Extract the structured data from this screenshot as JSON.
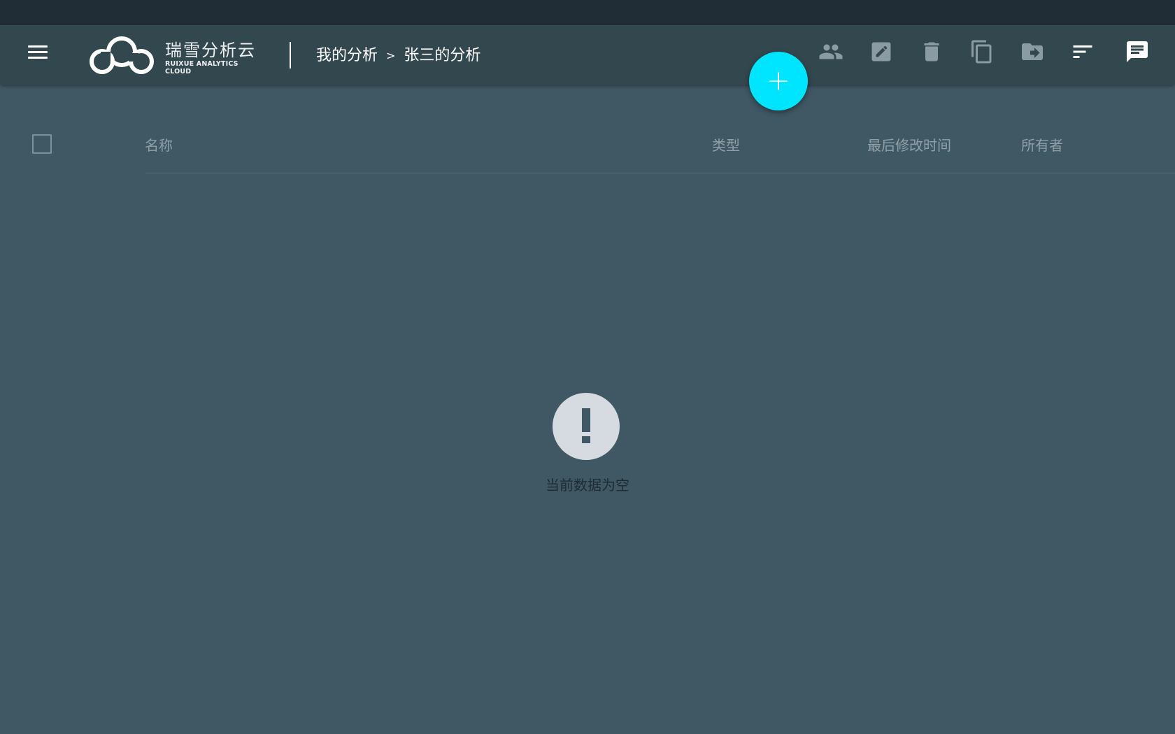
{
  "app": {
    "logo_cn": "瑞雪分析云",
    "logo_en": "RUIXUE ANALYTICS CLOUD"
  },
  "breadcrumb": {
    "items": [
      "我的分析",
      "张三的分析"
    ],
    "separator": ">"
  },
  "toolbar": {
    "icons": [
      "people-icon",
      "edit-icon",
      "delete-icon",
      "copy-icon",
      "move-to-folder-icon",
      "sort-icon",
      "comment-icon"
    ]
  },
  "fab": {
    "label": "+"
  },
  "table": {
    "columns": [
      "名称",
      "类型",
      "最后修改时间",
      "所有者"
    ],
    "rows": []
  },
  "empty_state": {
    "icon": "exclamation-icon",
    "message": "当前数据为空"
  },
  "colors": {
    "background": "#405864",
    "appbar": "#33474f",
    "topstrip": "#202d37",
    "accent": "#00e5ff"
  }
}
